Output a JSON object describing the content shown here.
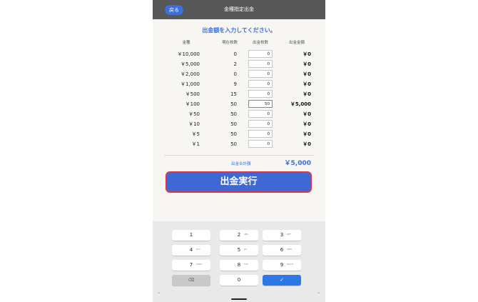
{
  "header": {
    "back_label": "戻る",
    "title": "金種指定出金"
  },
  "instruction": "出金額を入力してください。",
  "columns": {
    "denom": "金種",
    "count": "現在枚数",
    "input": "出金枚数",
    "amount": "出金金額"
  },
  "rows": [
    {
      "denom": "￥10,000",
      "count": "0",
      "input": "0",
      "amount": "￥0"
    },
    {
      "denom": "￥5,000",
      "count": "2",
      "input": "0",
      "amount": "￥0"
    },
    {
      "denom": "￥2,000",
      "count": "0",
      "input": "0",
      "amount": "￥0"
    },
    {
      "denom": "￥1,000",
      "count": "9",
      "input": "0",
      "amount": "￥0"
    },
    {
      "denom": "￥500",
      "count": "15",
      "input": "0",
      "amount": "￥0"
    },
    {
      "denom": "￥100",
      "count": "50",
      "input": "50",
      "amount": "￥5,000"
    },
    {
      "denom": "￥50",
      "count": "50",
      "input": "0",
      "amount": "￥0"
    },
    {
      "denom": "￥10",
      "count": "50",
      "input": "0",
      "amount": "￥0"
    },
    {
      "denom": "￥5",
      "count": "50",
      "input": "0",
      "amount": "￥0"
    },
    {
      "denom": "￥1",
      "count": "50",
      "input": "0",
      "amount": "￥0"
    }
  ],
  "total": {
    "label": "出金合計額",
    "value": "￥5,000"
  },
  "execute_label": "出金実行",
  "keypad": {
    "keys": [
      {
        "num": "1",
        "sub": ""
      },
      {
        "num": "2",
        "sub": "ABC"
      },
      {
        "num": "3",
        "sub": "DEF"
      },
      {
        "num": "4",
        "sub": "GHI"
      },
      {
        "num": "5",
        "sub": "JKL"
      },
      {
        "num": "6",
        "sub": "MNO"
      },
      {
        "num": "7",
        "sub": "PQRS"
      },
      {
        "num": "8",
        "sub": "TUV"
      },
      {
        "num": "9",
        "sub": "WXYZ"
      },
      {
        "num": "⌫",
        "sub": ""
      },
      {
        "num": "0",
        "sub": ""
      },
      {
        "num": "✓",
        "sub": ""
      }
    ]
  },
  "colors": {
    "accent": "#3c6fdb",
    "header_bg": "#575757",
    "execute_border": "#e23447",
    "enter_key": "#2d77e6"
  }
}
